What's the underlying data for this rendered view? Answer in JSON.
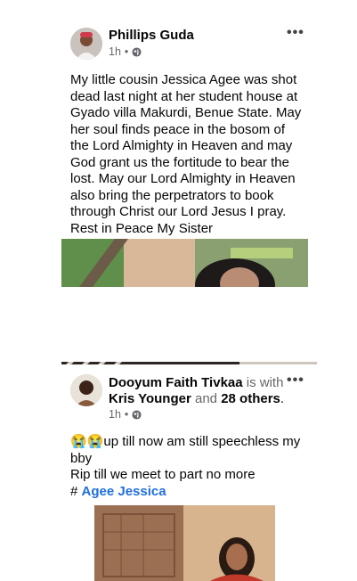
{
  "posts": [
    {
      "author": "Phillips Guda",
      "time": "1h",
      "dot": "•",
      "privacy_icon": "globe-icon",
      "more_label": "•••",
      "text": "My little cousin Jessica Agee was shot dead last night at her student house at Gyado villa Makurdi, Benue State. May her soul finds peace in the bosom of the Lord Almighty in Heaven and may God grant us the fortitude to bear the lost. May our Lord Almighty in Heaven also bring the perpetrators to book through Christ our Lord Jesus I pray. Rest in Peace My Sister"
    },
    {
      "author": "Dooyum Faith Tivkaa",
      "with_word": "is with",
      "tagged": "Kris Younger",
      "and_word": "and",
      "others": "28 others",
      "period": ".",
      "time": "1h",
      "dot": "•",
      "privacy_icon": "globe-icon",
      "more_label": "•••",
      "emoji": "😭😭",
      "line1": "up till now am still speechless my bby",
      "line2": "Rip till we meet to part no more",
      "hash_prefix": "#",
      "hashtag": "Agee Jessica"
    }
  ],
  "colors": {
    "meta": "#65676b",
    "link": "#216fdb",
    "divider": "#f0f2f5"
  }
}
